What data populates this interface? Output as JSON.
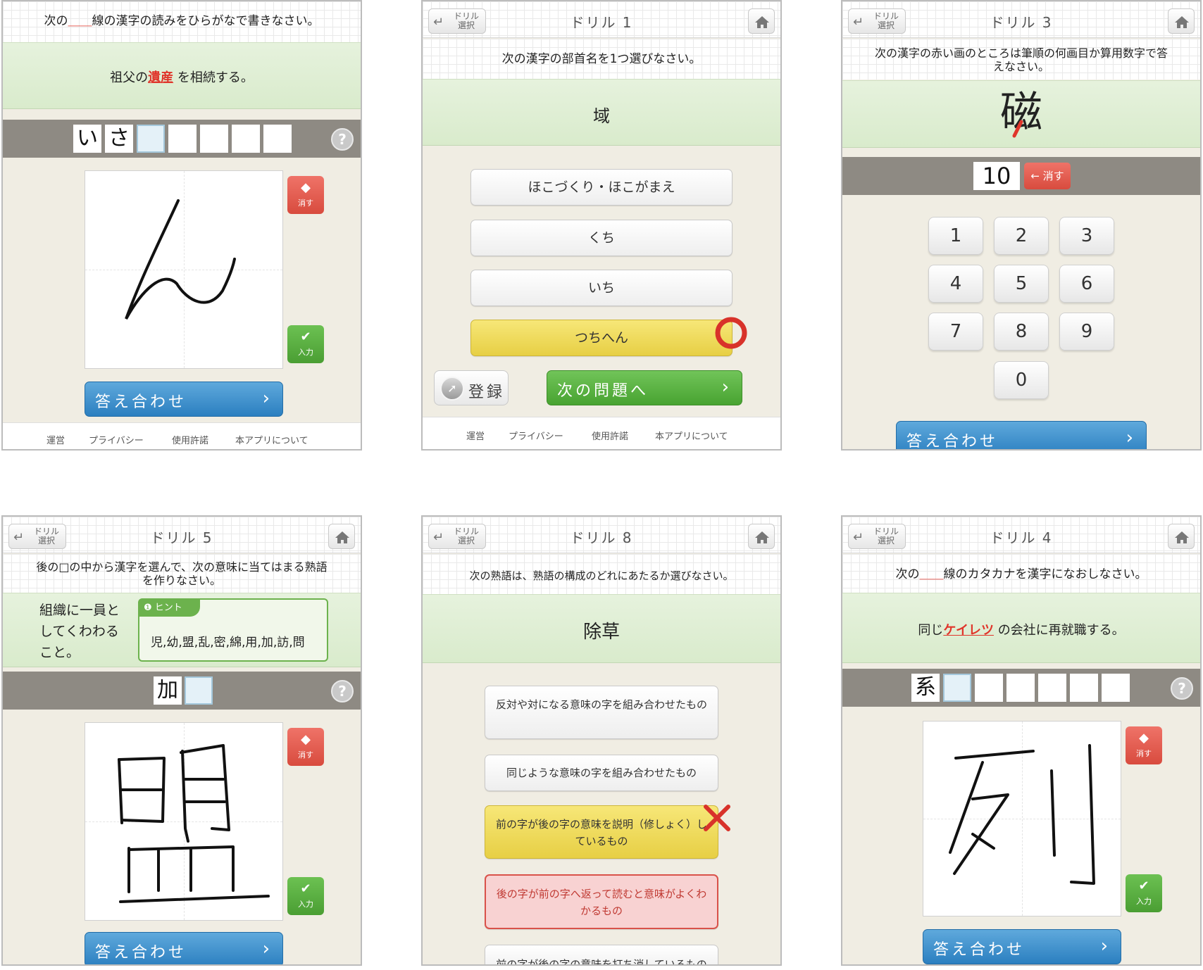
{
  "common": {
    "back_label": "ドリル\n選択",
    "check_label": "答え合わせ",
    "erase_label": "消す",
    "enter_label": "入力",
    "help_label": "?",
    "footer": [
      "運営",
      "プライバシー",
      "使用許諾",
      "本アプリについて"
    ],
    "accent_blue": "#2b7fc0",
    "accent_green": "#48a331",
    "accent_red": "#d84b3e"
  },
  "panel1": {
    "instruction_pre": "次の",
    "instruction_post": "線の漢字の読みをひらがなで書きなさい。",
    "question_pre": "祖父の",
    "question_target": "遺産",
    "question_post": "を相続する。",
    "answer_boxes": [
      "い",
      "さ",
      "",
      "",
      "",
      "",
      ""
    ]
  },
  "panel2": {
    "title": "ドリル 1",
    "instruction": "次の漢字の部首名を1つ選びなさい。",
    "question": "域",
    "options": [
      "ほこづくり・ほこがまえ",
      "くち",
      "いち",
      "つちへん"
    ],
    "register_label": "登録",
    "next_label": "次の問題へ"
  },
  "panel3": {
    "title": "ドリル 3",
    "instruction": "次の漢字の赤い画のところは筆順の何画目か算用数字で答えなさい。",
    "question": "磁",
    "answer_value": "10",
    "erase_label": "← 消す",
    "keys": [
      "1",
      "2",
      "3",
      "4",
      "5",
      "6",
      "7",
      "8",
      "9",
      "0"
    ]
  },
  "panel4": {
    "title": "ドリル 5",
    "instruction": "後の□の中から漢字を選んで、次の意味に当てはまる熟語を作りなさい。",
    "meaning": "組織に一員としてくわわること。",
    "hint_tag": "ヒント",
    "hint_text": "児,幼,盟,乱,密,綿,用,加,訪,問",
    "answer_boxes": [
      "加",
      ""
    ]
  },
  "panel5": {
    "title": "ドリル 8",
    "instruction": "次の熟語は、熟語の構成のどれにあたるか選びなさい。",
    "question": "除草",
    "options": [
      "反対や対になる意味の字を組み合わせたもの",
      "同じような意味の字を組み合わせたもの",
      "前の字が後の字の意味を説明（修しょく）しているもの",
      "後の字が前の字へ返って読むと意味がよくわかるもの",
      "前の字が後の字の意味を打ち消しているもの"
    ]
  },
  "panel6": {
    "title": "ドリル 4",
    "instruction_pre": "次の",
    "instruction_post": "線のカタカナを漢字になおしなさい。",
    "question_pre": "同じ",
    "question_target": "ケイレツ",
    "question_post": "の会社に再就職する。",
    "answer_boxes": [
      "系",
      "",
      "",
      "",
      "",
      "",
      ""
    ]
  }
}
